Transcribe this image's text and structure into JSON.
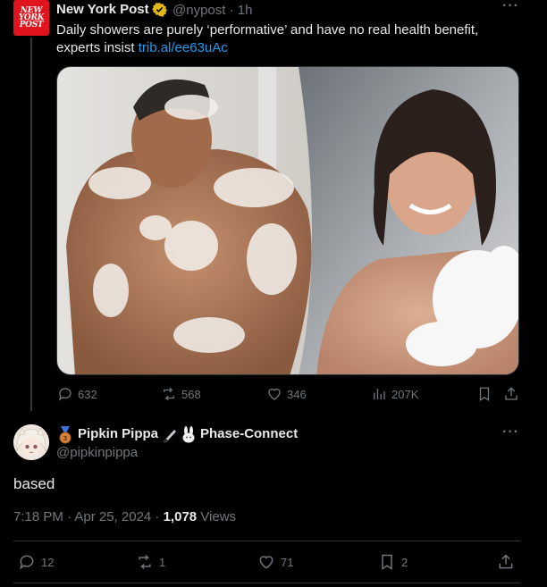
{
  "parent": {
    "avatar_text": [
      "NEW",
      "YORK",
      "POST"
    ],
    "author": "New York Post",
    "handle_time": "@nypost · 1h",
    "text": "Daily showers are purely ‘performative’ and have no real health benefit, experts insist ",
    "link": "trib.al/ee63uAc",
    "stats": {
      "replies": "632",
      "reposts": "568",
      "likes": "346",
      "views": "207K"
    }
  },
  "reply": {
    "author_part1": "Pipkin Pippa",
    "author_part2": "Phase-Connect",
    "handle": "@pipkinpippa",
    "text": "based",
    "timestamp": "7:18 PM · Apr 25, 2024 · ",
    "views_count": "1,078",
    "views_label": " Views",
    "stats": {
      "replies": "12",
      "reposts": "1",
      "likes": "71",
      "bookmarks": "2"
    }
  },
  "colors": {
    "background": "#000000",
    "text": "#e7e9ea",
    "muted": "#71767b",
    "link": "#1d9bf0",
    "brand_red": "#e1141d",
    "verified_gold": "#e2b719"
  },
  "icons": [
    "more-icon",
    "verified-badge-icon",
    "reply-icon",
    "repost-icon",
    "like-icon",
    "views-icon",
    "bookmark-icon",
    "share-icon",
    "medal-icon",
    "knife-icon",
    "bunny-icon"
  ]
}
